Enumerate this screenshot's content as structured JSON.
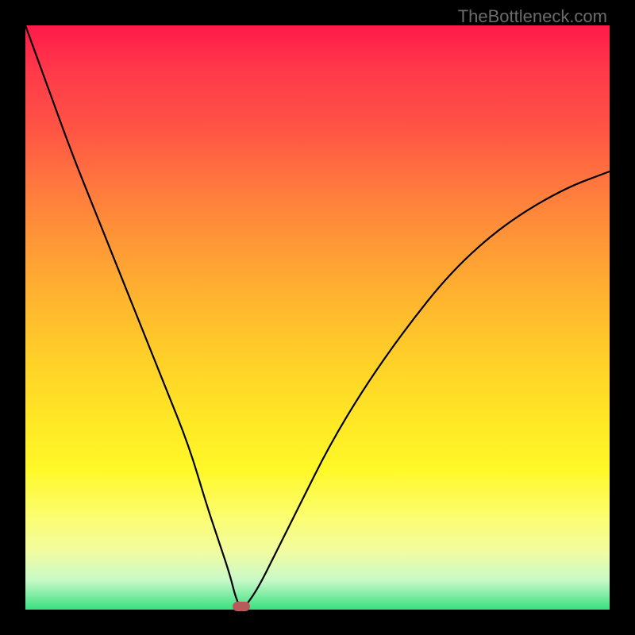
{
  "attribution": "TheBottleneck.com",
  "colors": {
    "background_black": "#000000",
    "gradient_top": "#ff1a4a",
    "gradient_bottom": "#38e080",
    "curve": "#000000",
    "marker": "#b85a5a",
    "attribution_text": "#6b6b6b"
  },
  "chart_data": {
    "type": "line",
    "title": "",
    "xlabel": "",
    "ylabel": "",
    "x_range": [
      0,
      100
    ],
    "y_range": [
      0,
      100
    ],
    "marker_position": {
      "x": 37,
      "y": 0
    },
    "series": [
      {
        "name": "bottleneck-curve",
        "x": [
          0,
          4,
          8,
          12,
          16,
          20,
          24,
          28,
          31,
          33,
          35,
          36,
          37,
          38,
          40,
          43,
          47,
          52,
          58,
          65,
          73,
          82,
          92,
          100
        ],
        "y": [
          100,
          89,
          78,
          68,
          58,
          48,
          38,
          28,
          18,
          12,
          6,
          2,
          0,
          1,
          4,
          10,
          18,
          28,
          38,
          48,
          58,
          66,
          72,
          75
        ]
      }
    ]
  }
}
